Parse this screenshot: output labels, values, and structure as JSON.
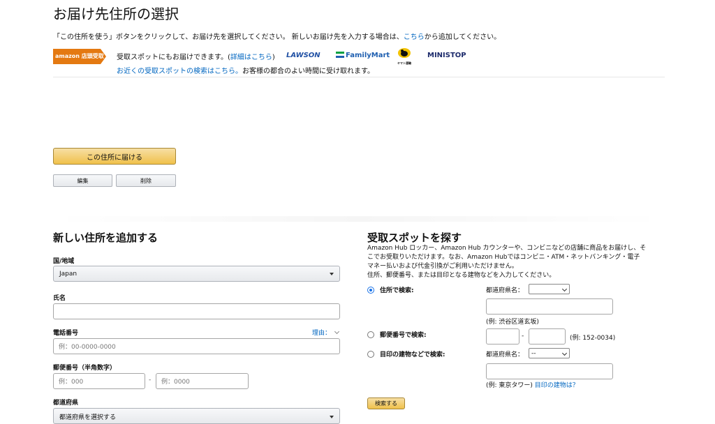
{
  "page": {
    "title": "お届け先住所の選択",
    "intro_pre": "「この住所を使う」ボタンをクリックして、お届け先を選択してください。 新しいお届け先を入力する場合は、",
    "intro_link": "こちら",
    "intro_post": "から追加してください。"
  },
  "pickup_banner": {
    "amazon_logo": "amazon 店頭受取",
    "line1_pre": "受取スポットにもお届けできます。(",
    "line1_link": "詳細はこちら",
    "line1_post": ")",
    "line2_link": "お近くの受取スポットの検索はこちら。",
    "line2_post": "お客様の都合のよい時間に受け取れます。",
    "brands": [
      "LAWSON",
      "FamilyMart",
      "ヤマト運輸",
      "MINISTOP"
    ]
  },
  "address_actions": {
    "deliver_label": "この住所に届ける",
    "edit_label": "編集",
    "delete_label": "削除"
  },
  "new_address": {
    "heading": "新しい住所を追加する",
    "country_label": "国/地域",
    "country_value": "Japan",
    "name_label": "氏名",
    "name_value": "",
    "phone_label": "電話番号",
    "phone_reason": "理由：",
    "phone_placeholder": "例：00-0000-0000",
    "postal_label": "郵便番号（半角数字）",
    "postal1_placeholder": "例：000",
    "postal_dash": "-",
    "postal2_placeholder": "例：0000",
    "pref_label": "都道府県",
    "pref_value": "都道府県を選択する"
  },
  "pickup_search": {
    "heading": "受取スポットを探す",
    "desc1": "Amazon Hub ロッカー、Amazon Hub カウンターや、コンビニなどの店舗に商品をお届けし、そ",
    "desc2": "こでお受取りいただけます。なお、Amazon Hubではコンビニ・ATM・ネットバンキング・電子",
    "desc3": "マネー払いおよび代金引換がご利用いただけません。",
    "desc4": "住所、郵便番号、または目印となる建物などを入力してください。",
    "opt_address": "住所で検索:",
    "pref_label1": "都道府県名：",
    "pref_select1": "",
    "address_example": "(例: 渋谷区道玄坂)",
    "opt_postal": "郵便番号で検索:",
    "postal_dash": "-",
    "postal_example": "(例: 152-0034)",
    "opt_landmark": "目印の建物などで検索:",
    "pref_label2": "都道府県名：",
    "pref_select2": "--",
    "landmark_example": "(例: 東京タワー)",
    "landmark_link": "目印の建物は？",
    "search_button": "検索する"
  }
}
